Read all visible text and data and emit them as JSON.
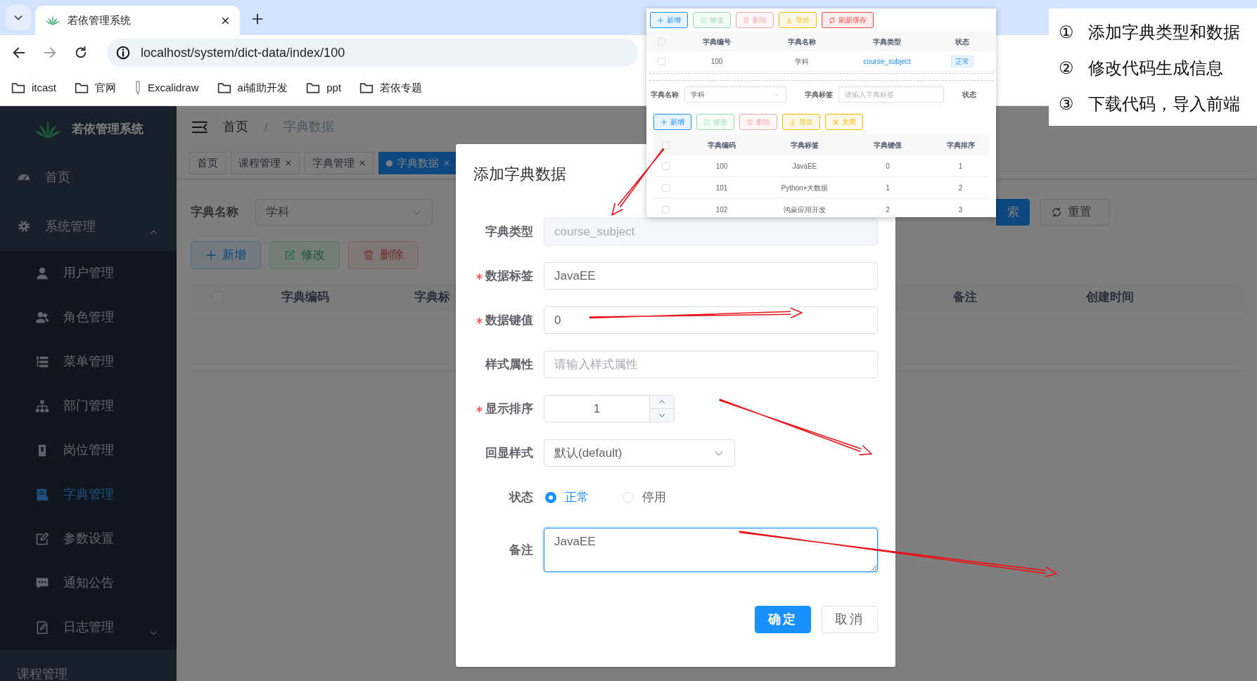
{
  "browser": {
    "tab_title": "若依管理系统",
    "url": "localhost/system/dict-data/index/100",
    "bookmarks": [
      {
        "label": "itcast",
        "kind": "folder"
      },
      {
        "label": "官网",
        "kind": "folder"
      },
      {
        "label": "Excalidraw",
        "kind": "site"
      },
      {
        "label": "ai辅助开发",
        "kind": "folder"
      },
      {
        "label": "ppt",
        "kind": "folder"
      },
      {
        "label": "若依专题",
        "kind": "folder"
      }
    ]
  },
  "sidebar": {
    "title": "若依管理系统",
    "items": [
      {
        "label": "首页",
        "selected": false
      },
      {
        "label": "系统管理",
        "selected": false,
        "expanded": true,
        "children": [
          {
            "label": "用户管理",
            "selected": false
          },
          {
            "label": "角色管理",
            "selected": false
          },
          {
            "label": "菜单管理",
            "selected": false
          },
          {
            "label": "部门管理",
            "selected": false
          },
          {
            "label": "岗位管理",
            "selected": false
          },
          {
            "label": "字典管理",
            "selected": true
          },
          {
            "label": "参数设置",
            "selected": false
          },
          {
            "label": "通知公告",
            "selected": false
          },
          {
            "label": "日志管理",
            "selected": false,
            "expanded": false
          }
        ]
      },
      {
        "label": "课程管理",
        "selected": false
      }
    ]
  },
  "breadcrumb": [
    "首页",
    "字典数据"
  ],
  "tags": [
    {
      "label": "首页",
      "selected": false,
      "closable": false
    },
    {
      "label": "课程管理",
      "selected": false,
      "closable": true
    },
    {
      "label": "字典管理",
      "selected": false,
      "closable": true
    },
    {
      "label": "字典数据",
      "selected": true,
      "closable": true
    }
  ],
  "search_form": {
    "label": "字典名称",
    "value": "学科",
    "search_button": "索",
    "reset_button": "重置"
  },
  "toolbar": [
    {
      "label": "新增",
      "kind": "primary",
      "disabled": false
    },
    {
      "label": "修改",
      "kind": "success",
      "disabled": true
    },
    {
      "label": "删除",
      "kind": "danger",
      "disabled": true
    }
  ],
  "table": {
    "columns": [
      "字典编码",
      "字典标",
      "备注",
      "创建时间"
    ],
    "all_checked": false
  },
  "dialog": {
    "title": "添加字典数据",
    "fields": [
      {
        "label": "字典类型",
        "kind": "text",
        "value": "course_subject",
        "required": false,
        "disabled": true,
        "focused": false
      },
      {
        "label": "数据标签",
        "kind": "text",
        "value": "JavaEE",
        "required": true,
        "disabled": false,
        "focused": false
      },
      {
        "label": "数据键值",
        "kind": "text",
        "value": "0",
        "required": true,
        "disabled": false,
        "focused": false
      },
      {
        "label": "样式属性",
        "kind": "text",
        "placeholder": "请输入样式属性",
        "required": false,
        "disabled": false,
        "focused": false
      },
      {
        "label": "显示排序",
        "kind": "number",
        "value": "1",
        "required": true,
        "disabled": false,
        "focused": false
      },
      {
        "label": "回显样式",
        "kind": "select",
        "value": "默认(default)",
        "required": false,
        "disabled": false,
        "focused": false
      },
      {
        "label": "状态",
        "kind": "radio",
        "options": [
          {
            "label": "正常",
            "selected": true
          },
          {
            "label": "停用",
            "selected": false
          }
        ],
        "required": false,
        "disabled": false,
        "focused": false
      },
      {
        "label": "备注",
        "kind": "textarea",
        "value": "JavaEE",
        "required": false,
        "disabled": false,
        "focused": true
      }
    ],
    "buttons": [
      {
        "label": "确定",
        "kind": "primary"
      },
      {
        "label": "取消",
        "kind": "default"
      }
    ]
  },
  "inset_screenshot": {
    "toolbar_top": [
      {
        "label": "新增",
        "kind": "primary",
        "disabled": false
      },
      {
        "label": "修改",
        "kind": "success",
        "disabled": true
      },
      {
        "label": "删除",
        "kind": "danger",
        "disabled": true
      },
      {
        "label": "导出",
        "kind": "warning",
        "disabled": false
      },
      {
        "label": "刷新缓存",
        "kind": "danger",
        "disabled": false
      }
    ],
    "type_table": {
      "columns": [
        "字典编号",
        "字典名称",
        "字典类型",
        "状态"
      ],
      "all_checked": false,
      "rows": [
        {
          "checked": false,
          "cells": [
            "100",
            "学科",
            "course_subject",
            "正常"
          ]
        }
      ]
    },
    "filters": [
      {
        "label": "字典名称",
        "kind": "select",
        "value": "学科"
      },
      {
        "label": "字典标签",
        "kind": "input",
        "placeholder": "请输入字典标签"
      },
      {
        "label": "状态",
        "kind": "label"
      }
    ],
    "toolbar_bottom": [
      {
        "label": "新增",
        "kind": "primary",
        "disabled": false
      },
      {
        "label": "修改",
        "kind": "success",
        "disabled": true
      },
      {
        "label": "删除",
        "kind": "danger",
        "disabled": true
      },
      {
        "label": "导出",
        "kind": "warning",
        "disabled": false
      },
      {
        "label": "关闭",
        "kind": "warning",
        "disabled": false
      }
    ],
    "data_table": {
      "columns": [
        "字典编码",
        "字典标签",
        "字典键值",
        "字典排序"
      ],
      "all_checked": false,
      "rows": [
        {
          "checked": false,
          "cells": [
            "100",
            "JavaEE",
            "0",
            "1"
          ]
        },
        {
          "checked": false,
          "cells": [
            "101",
            "Python+大数据",
            "1",
            "2"
          ]
        },
        {
          "checked": false,
          "cells": [
            "102",
            "鸿蒙应用开发",
            "2",
            "3"
          ]
        }
      ]
    }
  },
  "notes": [
    {
      "number": "①",
      "text": "添加字典类型和数据"
    },
    {
      "number": "②",
      "text": "修改代码生成信息"
    },
    {
      "number": "③",
      "text": "下载代码，导入前端"
    }
  ]
}
